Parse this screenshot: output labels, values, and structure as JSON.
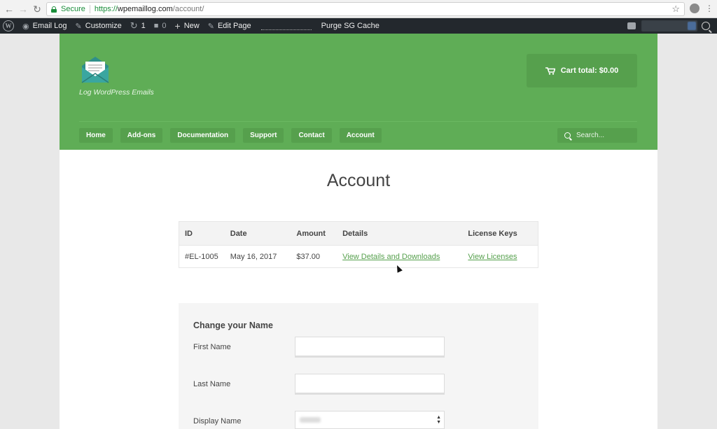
{
  "browser": {
    "secure_label": "Secure",
    "url_scheme": "https://",
    "url_host": "wpemaillog.com",
    "url_path": "/account/"
  },
  "adminbar": {
    "email_log": "Email Log",
    "customize": "Customize",
    "updates_count": "1",
    "comments_count": "0",
    "new": "New",
    "edit_page": "Edit Page",
    "purge_cache": "Purge SG Cache"
  },
  "site": {
    "tagline": "Log WordPress Emails",
    "cart_total": "Cart total: $0.00",
    "search_placeholder": "Search...",
    "nav": [
      "Home",
      "Add-ons",
      "Documentation",
      "Support",
      "Contact",
      "Account"
    ]
  },
  "page": {
    "title": "Account"
  },
  "orders": {
    "headers": [
      "ID",
      "Date",
      "Amount",
      "Details",
      "License Keys"
    ],
    "rows": [
      {
        "id": "#EL-1005",
        "date": "May 16, 2017",
        "amount": "$37.00",
        "details": "View Details and Downloads",
        "licenses": "View Licenses"
      }
    ]
  },
  "name_form": {
    "title": "Change your Name",
    "first_name_label": "First Name",
    "last_name_label": "Last Name",
    "display_name_label": "Display Name"
  },
  "colors": {
    "brand_green": "#5fad56",
    "link_green": "#56a04d",
    "admin_bar": "#23282d"
  }
}
